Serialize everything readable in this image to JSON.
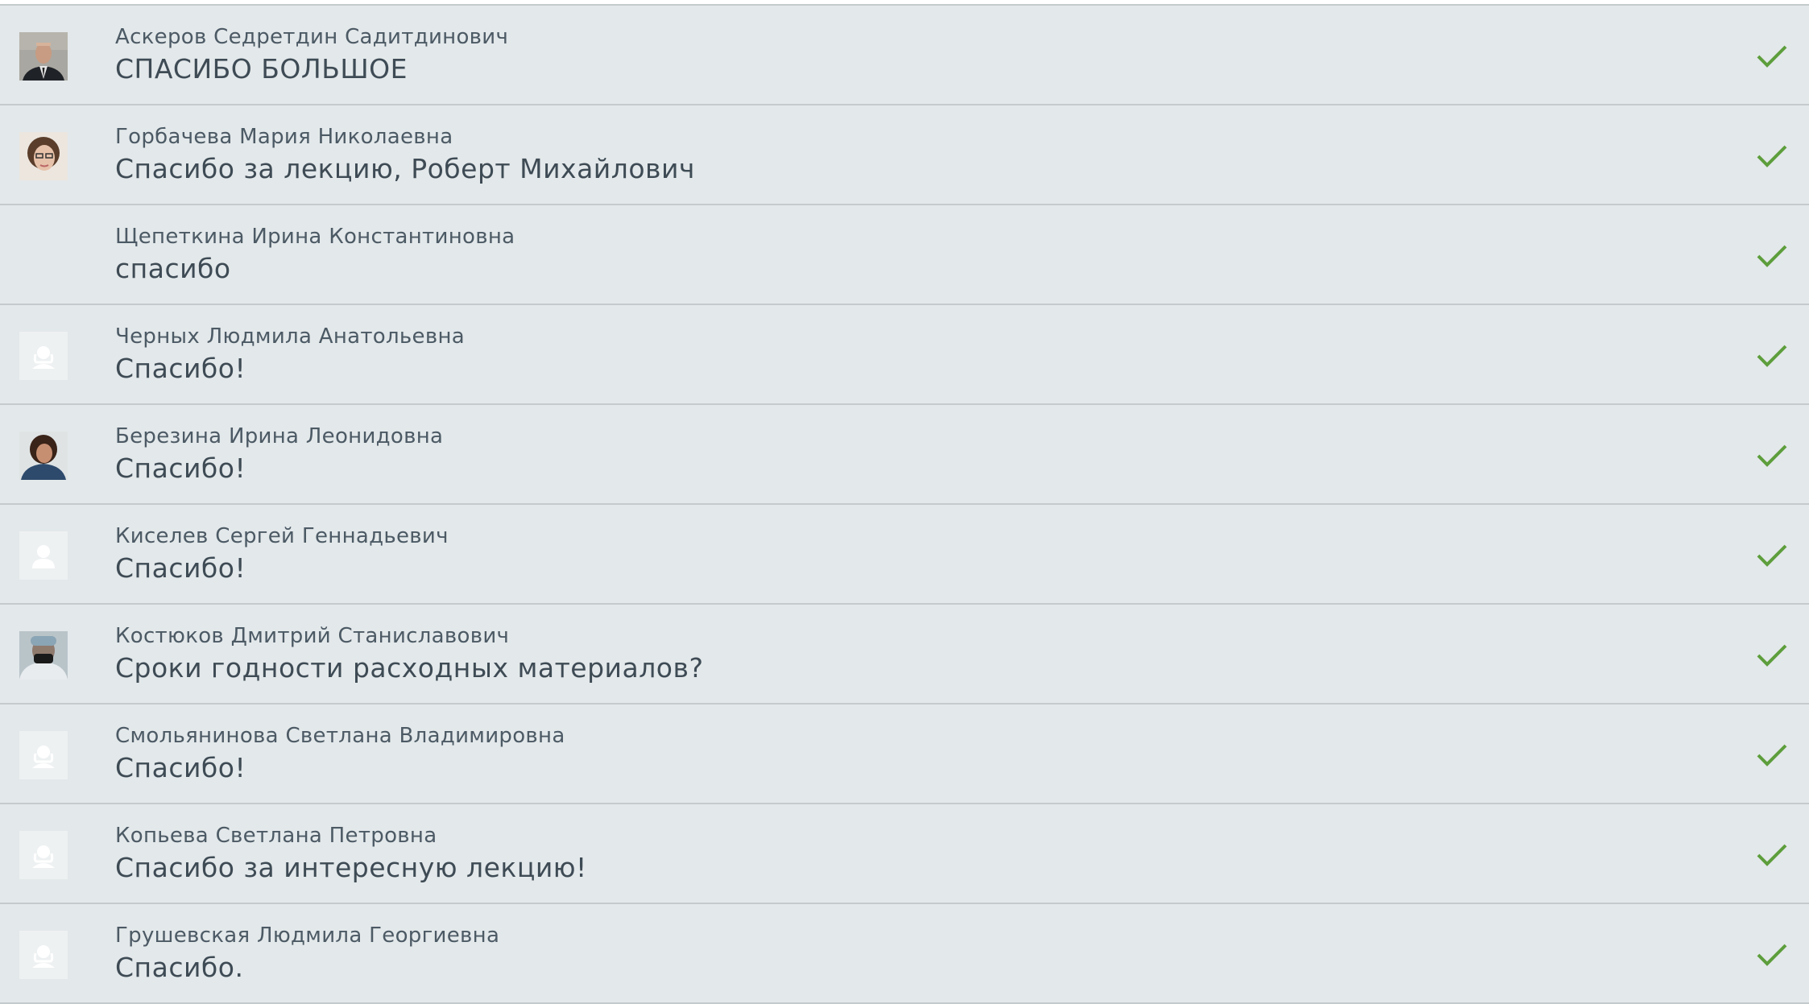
{
  "messages": [
    {
      "name": "Аскеров Седретдин Садитдинович",
      "text": "СПАСИБО БОЛЬШОЕ",
      "avatar": "photo-man-suit",
      "status": "read-check-icon"
    },
    {
      "name": "Горбачева Мария Николаевна",
      "text": "Спасибо за лекцию, Роберт Михайлович",
      "avatar": "photo-woman-glasses",
      "status": "read-check-icon"
    },
    {
      "name": "Щепеткина Ирина Константиновна",
      "text": "спасибо",
      "avatar": "none",
      "status": "read-check-icon"
    },
    {
      "name": "Черных Людмила Анатольевна",
      "text": "Спасибо!",
      "avatar": "placeholder-female",
      "status": "read-check-icon"
    },
    {
      "name": "Березина Ирина Леонидовна",
      "text": "Спасибо!",
      "avatar": "photo-woman-dark-hair",
      "status": "read-check-icon"
    },
    {
      "name": "Киселев Сергей Геннадьевич",
      "text": "Спасибо!",
      "avatar": "placeholder-male",
      "status": "read-check-icon"
    },
    {
      "name": "Костюков Дмитрий Станиславович",
      "text": "Сроки годности расходных материалов?",
      "avatar": "photo-man-mask",
      "status": "read-check-icon"
    },
    {
      "name": "Смольянинова Светлана Владимировна",
      "text": "Спасибо!",
      "avatar": "placeholder-female",
      "status": "read-check-icon"
    },
    {
      "name": "Копьева Светлана Петровна",
      "text": "Спасибо за интересную лекцию!",
      "avatar": "placeholder-female",
      "status": "read-check-icon"
    },
    {
      "name": "Грушевская Людмила Георгиевна",
      "text": "Спасибо.",
      "avatar": "placeholder-female",
      "status": "read-check-icon"
    }
  ],
  "colors": {
    "row_bg": "#e3e8ea",
    "divider": "#c5cacd",
    "check": "#5d9e3c",
    "name_text": "#4c5a65"
  }
}
